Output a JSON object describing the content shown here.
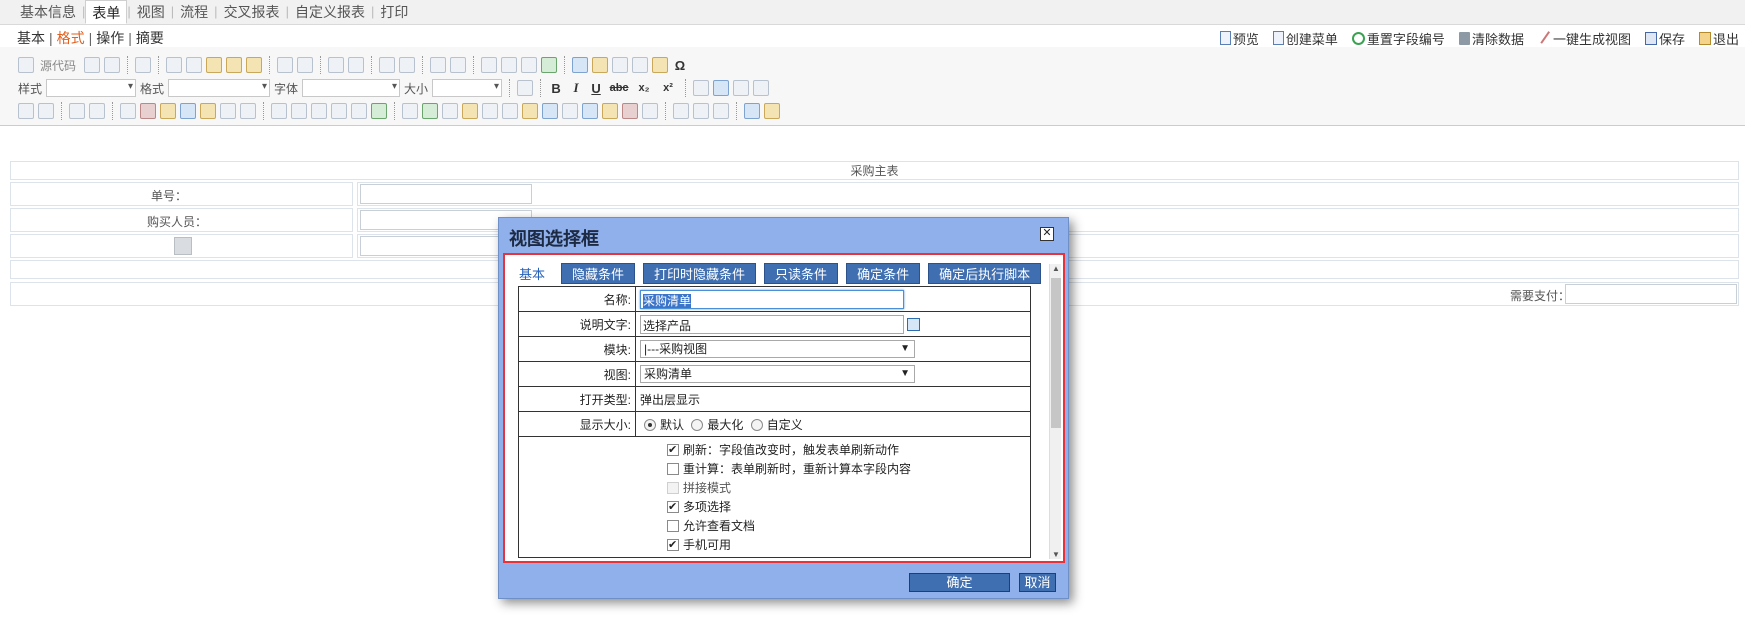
{
  "top_tabs": [
    "基本信息",
    "表单",
    "视图",
    "流程",
    "交叉报表",
    "自定义报表",
    "打印"
  ],
  "top_tabs_active": "表单",
  "subnav": {
    "items": [
      "基本",
      "格式",
      "操作",
      "摘要"
    ],
    "active": "格式"
  },
  "actions": [
    "预览",
    "创建菜单",
    "重置字段编号",
    "清除数据",
    "一键生成视图",
    "保存",
    "退出"
  ],
  "editor_toolbar": {
    "source_label": "源代码",
    "style_label": "样式",
    "format_label": "格式",
    "font_label": "字体",
    "size_label": "大小",
    "omega": "Ω",
    "bold": "B",
    "italic": "I",
    "underline": "U",
    "strike": "abc",
    "sub": "x₂",
    "sup": "x²"
  },
  "form": {
    "title": "采购主表",
    "order_no_label": "单号：",
    "buyer_label": "购买人员：",
    "pay_label": "需要支付："
  },
  "dialog": {
    "title": "视图选择框",
    "close": "☒",
    "tab_basic": "基本",
    "tab_buttons": [
      "隐藏条件",
      "打印时隐藏条件",
      "只读条件",
      "确定条件",
      "确定后执行脚本"
    ],
    "fields": {
      "name_label": "名称:",
      "name_value": "采购清单",
      "desc_label": "说明文字:",
      "desc_value": "选择产品",
      "module_label": "模块:",
      "module_value": "|---采购视图",
      "view_label": "视图:",
      "view_value": "采购清单",
      "open_type_label": "打开类型:",
      "open_type_value": "弹出层显示",
      "size_label": "显示大小:",
      "size_options": [
        "默认",
        "最大化",
        "自定义"
      ],
      "size_selected": "默认"
    },
    "checkboxes": [
      {
        "label": "刷新：字段值改变时，触发表单刷新动作",
        "checked": true,
        "disabled": false
      },
      {
        "label": "重计算：表单刷新时，重新计算本字段内容",
        "checked": false,
        "disabled": false
      },
      {
        "label": "拼接模式",
        "checked": false,
        "disabled": true
      },
      {
        "label": "多项选择",
        "checked": true,
        "disabled": false
      },
      {
        "label": "允许查看文档",
        "checked": false,
        "disabled": false
      },
      {
        "label": "手机可用",
        "checked": true,
        "disabled": false
      }
    ],
    "ok_label": "确定",
    "cancel_label": "取消"
  }
}
